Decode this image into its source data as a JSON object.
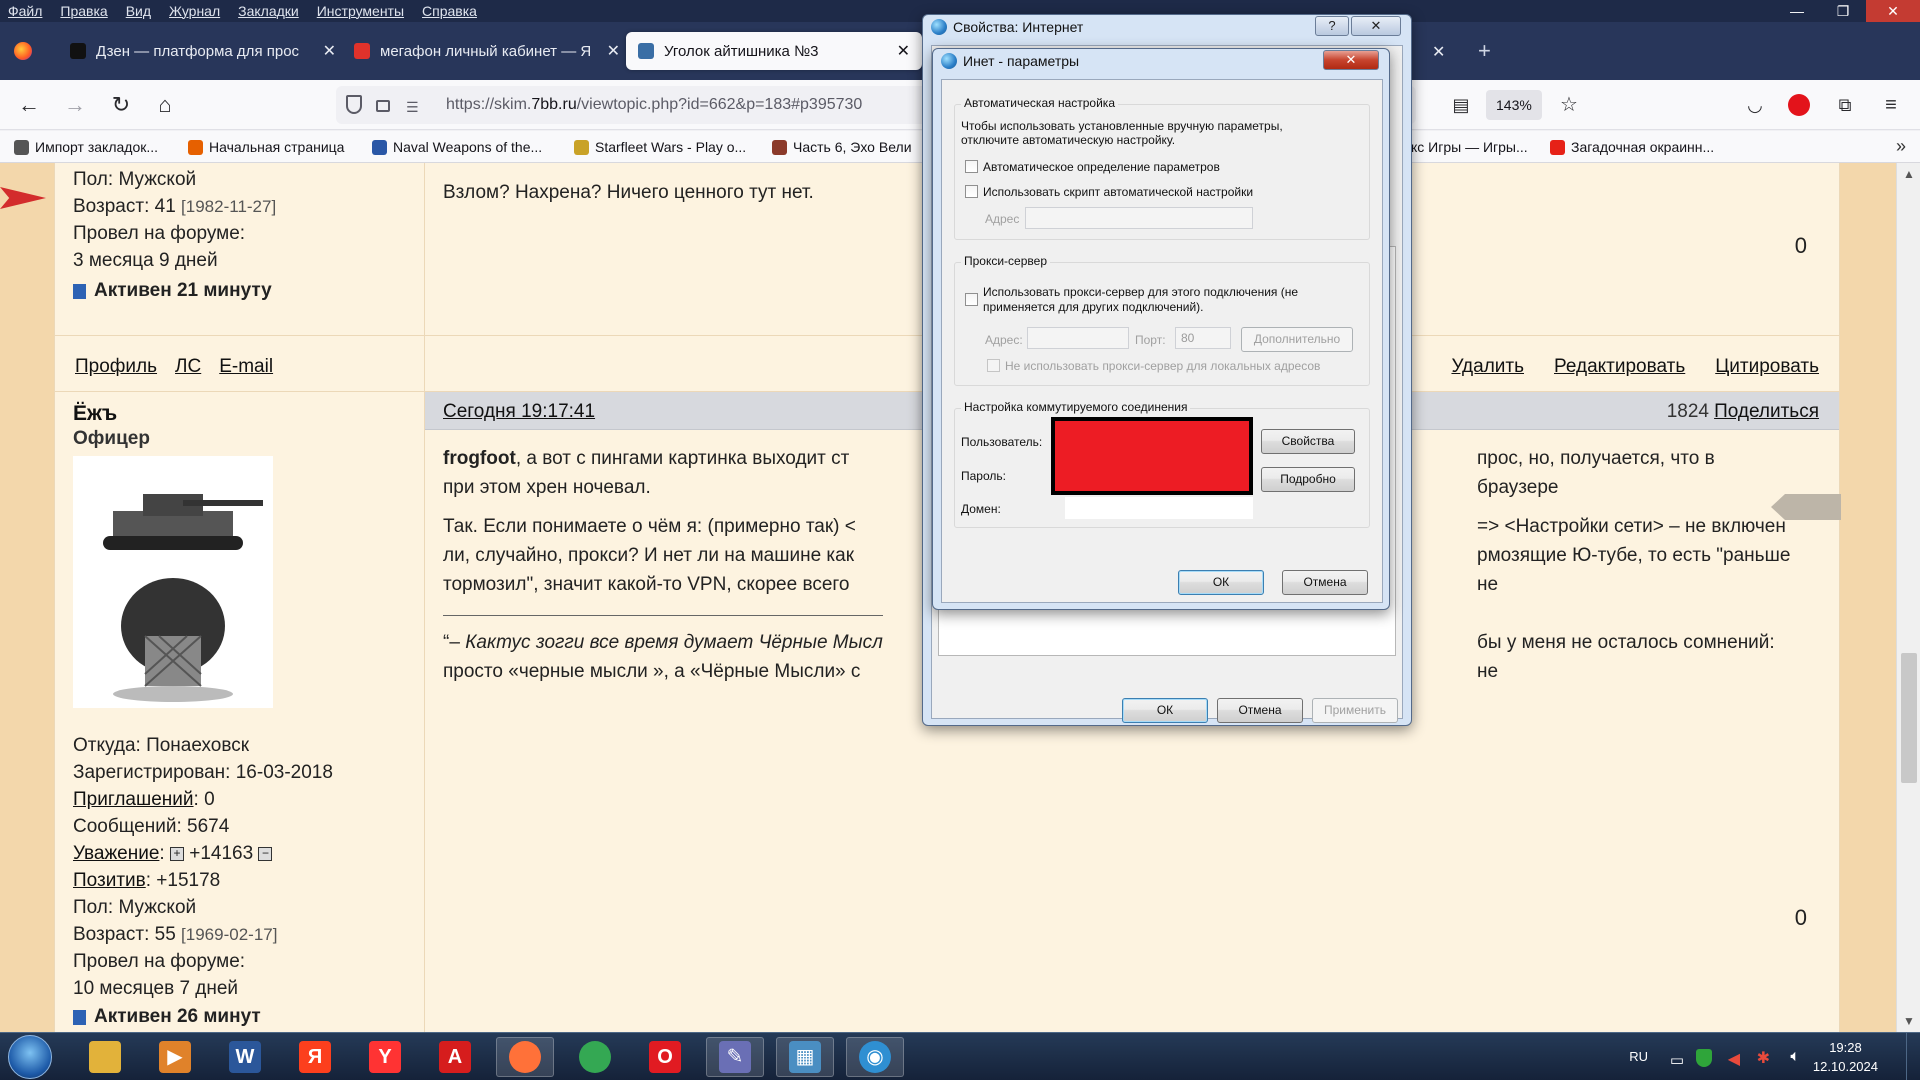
{
  "menu": [
    "Файл",
    "Правка",
    "Вид",
    "Журнал",
    "Закладки",
    "Инструменты",
    "Справка"
  ],
  "window_controls": {
    "minimize": "—",
    "maximize": "❐",
    "close": "✕"
  },
  "tabs": [
    {
      "title": "Дзен — платформа для прос",
      "color": "#111111",
      "active": false
    },
    {
      "title": "мегафон личный кабинет — Я",
      "color": "#e0322b",
      "active": false
    },
    {
      "title": "Уголок айтишника №3",
      "color": "#3a6ea5",
      "active": true
    },
    {
      "title": "",
      "color": "#c8a040",
      "active": false
    }
  ],
  "tab_close": "✕",
  "new_tab": "+",
  "nav": {
    "url_host": "https://skim.",
    "url_domain": "7bb.ru",
    "url_path": "/viewtopic.php?id=662&p=183#p395730",
    "zoom": "143%"
  },
  "bookmarks": [
    {
      "label": "Импорт закладок...",
      "color": "#555555"
    },
    {
      "label": "Начальная страница",
      "color": "#e66000"
    },
    {
      "label": "Naval Weapons of the...",
      "color": "#2a57a6"
    },
    {
      "label": "Starfleet Wars - Play o...",
      "color": "#c9a227"
    },
    {
      "label": "Часть 6, Эхо Вели",
      "color": "#8b3a2a"
    },
    {
      "label": "кс Игры — Игры...",
      "color": "#3a7bd5"
    },
    {
      "label": "Загадочная окраинн...",
      "color": "#e62117"
    }
  ],
  "post1": {
    "gender": "Пол: Мужской",
    "age": "Возраст: 41",
    "birth": "[1982-11-27]",
    "time_label": "Провел на форуме:",
    "time_value": "3 месяца 9 дней",
    "active": "Активен 21 минуту",
    "text": "Взлом? Нахрена? Ничего ценного тут нет.",
    "rating": "0",
    "links": {
      "profile": "Профиль",
      "pm": "ЛС",
      "email": "E-mail"
    },
    "actions": {
      "delete": "Удалить",
      "edit": "Редактировать",
      "quote": "Цитировать"
    }
  },
  "post2": {
    "author": "Ёжъ",
    "rank": "Офицер",
    "date": "Сегодня 19:17:41",
    "post_number": "1824",
    "share": "Поделиться",
    "from": "Откуда: Понаеховск",
    "registered": "Зарегистрирован: 16-03-2018",
    "invites_label": "Приглашений",
    "invites_value": ": 0",
    "messages": "Сообщений: 5674",
    "respect_label": "Уважение",
    "respect_value": "+14163",
    "positive_label": "Позитив",
    "positive_value": ": +15178",
    "gender": "Пол: Мужской",
    "age": "Возраст: 55",
    "birth": "[1969-02-17]",
    "time_label": "Провел на форуме:",
    "time_value": "10 месяцев 7 дней",
    "active": "Активен 26 минут",
    "p1_bold": "frogfoot",
    "p1_a": ", а вот с пингами картинка выходит ст",
    "p1_b": "прос, но, получается, что в браузере",
    "p1_c": "при этом хрен ночевал.",
    "p2_a": "Так. Если понимаете о чём я: (примерно так) <",
    "p2_b": "=> <Настройки сети> – не включен",
    "p2_c": "ли, случайно, прокси? И нет ли на машине как",
    "p2_d": "рмозящие Ю-тубе, то есть \"раньше не",
    "p2_e": "тормозил\", значит какой-то VPN, скорее всего",
    "sig_a": "“– ",
    "sig_b": "Кактус зогги все время думает Чёрные Мысл",
    "sig_c": "бы у меня не осталось сомнений: не",
    "sig_d": "просто «черные мысли », а «Чёрные Мысли» с",
    "rating": "0"
  },
  "dialog_outer": {
    "title": "Свойства: Интернет",
    "help": "?",
    "close": "✕",
    "ok": "ОК",
    "cancel": "Отмена",
    "apply": "Применить"
  },
  "dialog_inner": {
    "title": "Инет - параметры",
    "close": "✕",
    "auto_group": "Автоматическая настройка",
    "auto_desc_1": "Чтобы использовать установленные вручную параметры,",
    "auto_desc_2": "отключите автоматическую настройку.",
    "auto_detect": "Автоматическое определение параметров",
    "auto_script": "Использовать скрипт автоматической настройки",
    "address_label": "Адрес",
    "proxy_group": "Прокси-сервер",
    "use_proxy_1": "Использовать прокси-сервер для этого подключения (не",
    "use_proxy_2": "применяется для других подключений).",
    "proxy_address_label": "Адрес:",
    "port_label": "Порт:",
    "port_value": "80",
    "advanced": "Дополнительно",
    "bypass_local": "Не использовать прокси-сервер для локальных адресов",
    "dialup_group": "Настройка коммутируемого соединения",
    "user_label": "Пользователь:",
    "password_label": "Пароль:",
    "domain_label": "Домен:",
    "properties": "Свойства",
    "details": "Подробно",
    "ok": "ОК",
    "cancel": "Отмена",
    "redaction_color": "#ed1c24"
  },
  "taskbar": {
    "apps": [
      {
        "name": "explorer-icon",
        "glyph": "",
        "color": "#e2b23a",
        "active": false
      },
      {
        "name": "media-player-icon",
        "glyph": "▶",
        "color": "#e0822a",
        "active": false
      },
      {
        "name": "word-icon",
        "glyph": "W",
        "color": "#2b579a",
        "active": false
      },
      {
        "name": "yandex-icon",
        "glyph": "Я",
        "color": "#fc3f1d",
        "active": false
      },
      {
        "name": "yandex-browser-icon",
        "glyph": "Y",
        "color": "#ff3333",
        "active": false
      },
      {
        "name": "acrobat-icon",
        "glyph": "A",
        "color": "#d61d1d",
        "active": false
      },
      {
        "name": "firefox-icon",
        "glyph": "",
        "color": "#ff7139",
        "active": true
      },
      {
        "name": "chrome-icon",
        "glyph": "",
        "color": "#34a853",
        "active": false
      },
      {
        "name": "opera-icon",
        "glyph": "O",
        "color": "#e11b22",
        "active": false
      },
      {
        "name": "tool-icon",
        "glyph": "✎",
        "color": "#6a6fb5",
        "active": true
      },
      {
        "name": "control-panel-icon",
        "glyph": "▦",
        "color": "#4a8ec2",
        "active": true
      },
      {
        "name": "internet-options-icon",
        "glyph": "◉",
        "color": "#2f8fd2",
        "active": true
      }
    ],
    "lang": "RU",
    "time": "19:28",
    "date": "12.10.2024"
  }
}
